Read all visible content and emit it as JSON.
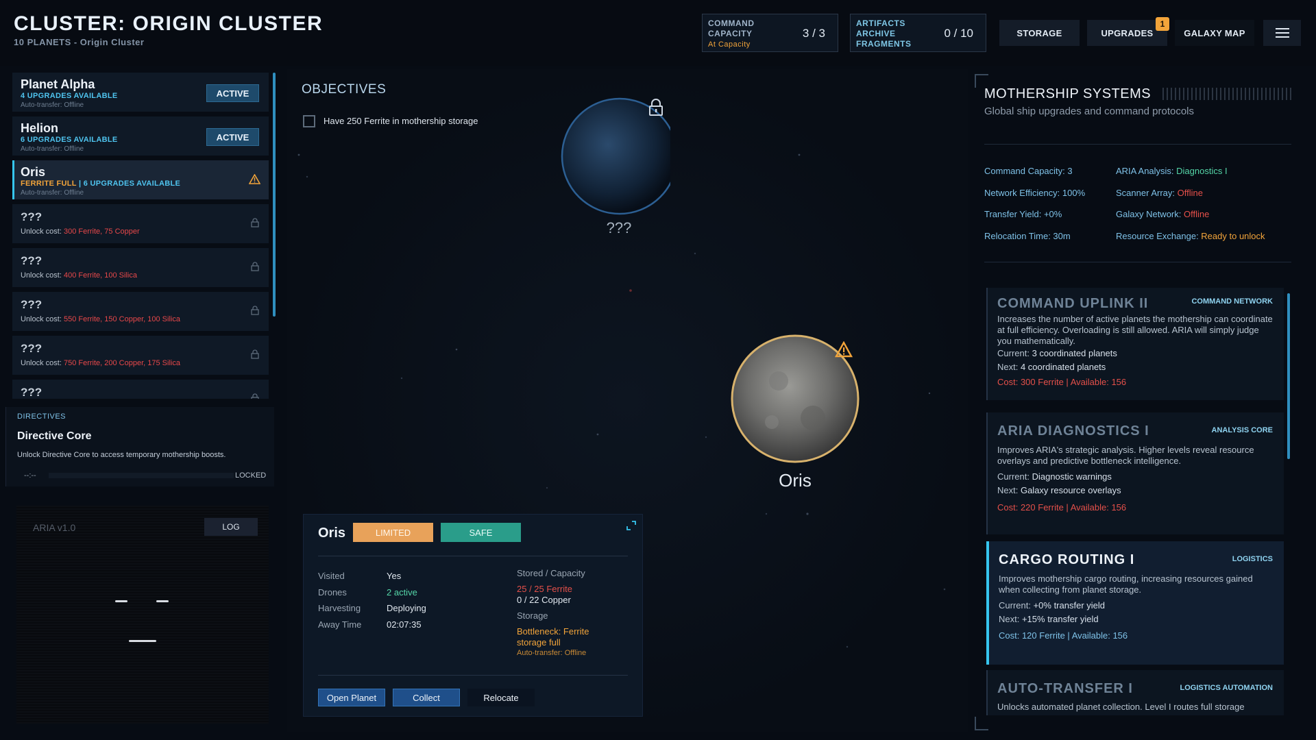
{
  "header": {
    "title": "CLUSTER: ORIGIN CLUSTER",
    "subtitle": "10 PLANETS - Origin Cluster",
    "command": {
      "label1": "COMMAND",
      "label2": "CAPACITY",
      "status": "At Capacity",
      "value": "3 / 3"
    },
    "artifacts": {
      "label1": "ARTIFACTS",
      "label2": "ARCHIVE",
      "label3": "FRAGMENTS",
      "value": "0 / 10"
    },
    "storage_label": "STORAGE",
    "upgrades_label": "UPGRADES",
    "upgrades_badge": "1",
    "galaxy_label": "GALAXY MAP"
  },
  "planets": [
    {
      "name": "Planet Alpha",
      "line2": "4 UPGRADES AVAILABLE",
      "line3": "Auto-transfer: Offline",
      "action": "ACTIVE"
    },
    {
      "name": "Helion",
      "line2": "6 UPGRADES AVAILABLE",
      "line3": "Auto-transfer: Offline",
      "action": "ACTIVE"
    },
    {
      "name": "Oris",
      "line2a": "FERRITE FULL",
      "line2b": " | 6 UPGRADES AVAILABLE",
      "line3": "Auto-transfer: Offline"
    }
  ],
  "locked": [
    {
      "name": "???",
      "prefix": "Unlock cost: ",
      "cost": "300 Ferrite, 75 Copper"
    },
    {
      "name": "???",
      "prefix": "Unlock cost: ",
      "cost": "400 Ferrite, 100 Silica"
    },
    {
      "name": "???",
      "prefix": "Unlock cost: ",
      "cost": "550 Ferrite, 150 Copper, 100 Silica"
    },
    {
      "name": "???",
      "prefix": "Unlock cost: ",
      "cost": "750 Ferrite, 200 Copper, 175 Silica"
    },
    {
      "name": "???"
    }
  ],
  "directives": {
    "header": "DIRECTIVES",
    "title": "Directive Core",
    "desc": "Unlock Directive Core to access temporary mothership boosts.",
    "timer": "--:--",
    "status": "LOCKED"
  },
  "aria": {
    "label": "ARIA v1.0",
    "log": "LOG"
  },
  "objectives": {
    "title": "OBJECTIVES",
    "item": "Have 250 Ferrite in mothership storage"
  },
  "map": {
    "unknown_label": "???",
    "oris_label": "Oris"
  },
  "card": {
    "name": "Oris",
    "badge_limited": "LIMITED",
    "badge_safe": "SAFE",
    "rows": [
      {
        "k": "Visited",
        "v": "Yes"
      },
      {
        "k": "Drones",
        "v": "2 active"
      },
      {
        "k": "Harvesting",
        "v": "Deploying"
      },
      {
        "k": "Away Time",
        "v": "02:07:35"
      }
    ],
    "stored_label": "Stored / Capacity",
    "ferrite": "25 / 25 Ferrite",
    "copper": "0 / 22 Copper",
    "storage_label": "Storage",
    "bottleneck1": "Bottleneck: Ferrite",
    "bottleneck2": "storage full",
    "autotransfer": "Auto-transfer: Offline",
    "btn_open": "Open Planet",
    "btn_collect": "Collect",
    "btn_relocate": "Relocate"
  },
  "mothership": {
    "title": "MOTHERSHIP SYSTEMS",
    "subtitle": "Global ship upgrades and command protocols",
    "stats_left": [
      "Command Capacity: 3",
      "Network Efficiency: 100%",
      "Transfer Yield: +0%",
      "Relocation Time: 30m"
    ],
    "stats_right": [
      {
        "k": "ARIA Analysis: ",
        "v": "Diagnostics I"
      },
      {
        "k": "Scanner Array: ",
        "v": "Offline"
      },
      {
        "k": "Galaxy Network: ",
        "v": "Offline"
      },
      {
        "k": "Resource Exchange: ",
        "v": "Ready to unlock"
      }
    ]
  },
  "upgrades": [
    {
      "title": "COMMAND UPLINK II",
      "tag": "COMMAND NETWORK",
      "desc": "Increases the number of active planets the mothership can coordinate at full efficiency. Overloading is still allowed. ARIA will simply judge you mathematically.",
      "current_k": "Current: ",
      "current": "3 coordinated planets",
      "next_k": "Next: ",
      "next": "4 coordinated planets",
      "cost": "Cost: 300 Ferrite  |  Available: 156"
    },
    {
      "title": "ARIA DIAGNOSTICS I",
      "tag": "ANALYSIS CORE",
      "desc": "Improves ARIA's strategic analysis. Higher levels reveal resource overlays and predictive bottleneck intelligence.",
      "current_k": "Current: ",
      "current": "Diagnostic warnings",
      "next_k": "Next: ",
      "next": "Galaxy resource overlays",
      "cost": "Cost: 220 Ferrite  |  Available: 156"
    },
    {
      "title": "CARGO ROUTING I",
      "tag": "LOGISTICS",
      "desc": "Improves mothership cargo routing, increasing resources gained when collecting from planet storage.",
      "current_k": "Current: ",
      "current": "+0% transfer yield",
      "next_k": "Next: ",
      "next": "+15% transfer yield",
      "cost": "Cost: 120 Ferrite  |  Available: 156"
    },
    {
      "title": "AUTO-TRANSFER I",
      "tag": "LOGISTICS AUTOMATION",
      "desc": "Unlocks automated planet collection. Level I routes full storage"
    }
  ],
  "colors": {
    "accent": "#36c6f0",
    "warning": "#f2a43a",
    "danger": "#e5504a",
    "safe": "#2a9d8a"
  }
}
